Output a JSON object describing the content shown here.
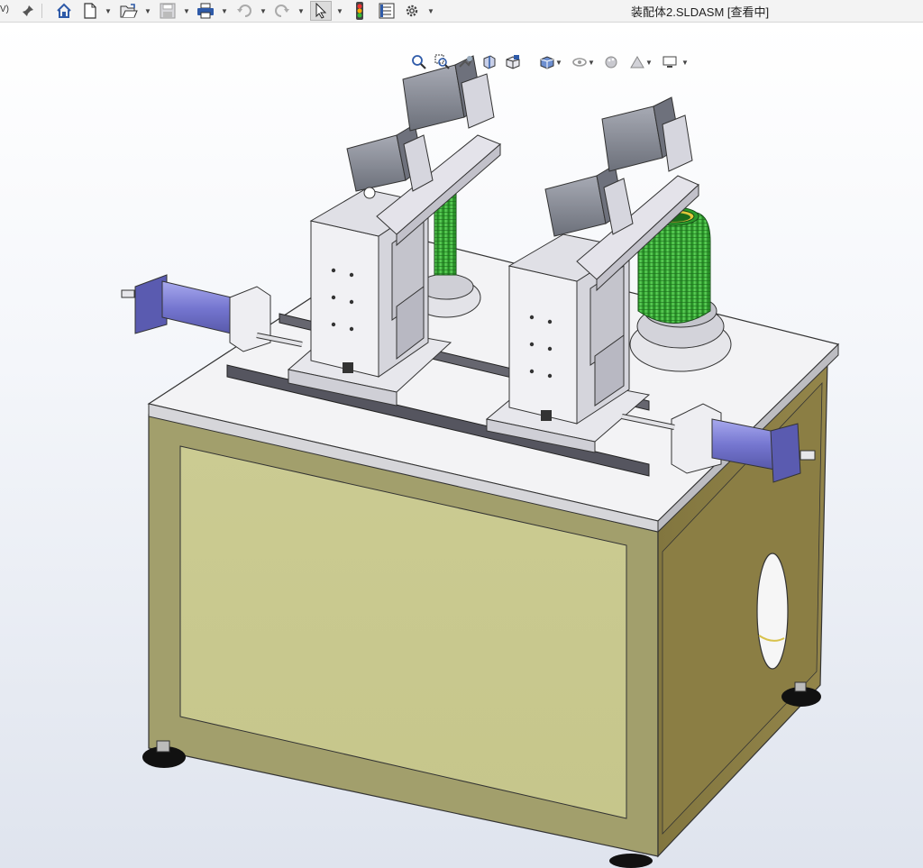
{
  "window": {
    "title": "装配体2.SLDASM [查看中]",
    "edge_label": "V)"
  },
  "toolbar": {
    "items": [
      {
        "name": "pin-icon",
        "label": "Pin"
      },
      {
        "name": "home-icon",
        "label": "Home"
      },
      {
        "name": "new-document-icon",
        "label": "New"
      },
      {
        "name": "open-icon",
        "label": "Open"
      },
      {
        "name": "save-icon",
        "label": "Save"
      },
      {
        "name": "print-icon",
        "label": "Print"
      },
      {
        "name": "undo-icon",
        "label": "Undo"
      },
      {
        "name": "redo-icon",
        "label": "Redo"
      },
      {
        "name": "select-icon",
        "label": "Select"
      },
      {
        "name": "rebuild-icon",
        "label": "Rebuild"
      },
      {
        "name": "file-properties-icon",
        "label": "File Properties"
      },
      {
        "name": "options-icon",
        "label": "Options"
      }
    ]
  },
  "view_toolbar": {
    "items": [
      {
        "name": "zoom-to-fit-icon"
      },
      {
        "name": "zoom-to-area-icon"
      },
      {
        "name": "previous-view-icon"
      },
      {
        "name": "section-view-icon"
      },
      {
        "name": "view-orientation-icon"
      },
      {
        "name": "display-style-icon"
      },
      {
        "name": "hide-show-items-icon"
      },
      {
        "name": "edit-appearance-icon"
      },
      {
        "name": "apply-scene-icon"
      },
      {
        "name": "view-settings-icon"
      }
    ]
  },
  "colors": {
    "cabinet_panel": "#c9c98f",
    "cabinet_frame": "#9a9a66",
    "cabinet_side": "#8a7d45",
    "table_top": "#f2f2f4",
    "metal_light": "#e9e8ee",
    "metal_mid": "#c4c3cc",
    "cylinder_blue": "#7f80d6",
    "motor_gray": "#8c8f99",
    "bellows_green": "#3fb43b",
    "rail_dark": "#555560"
  }
}
